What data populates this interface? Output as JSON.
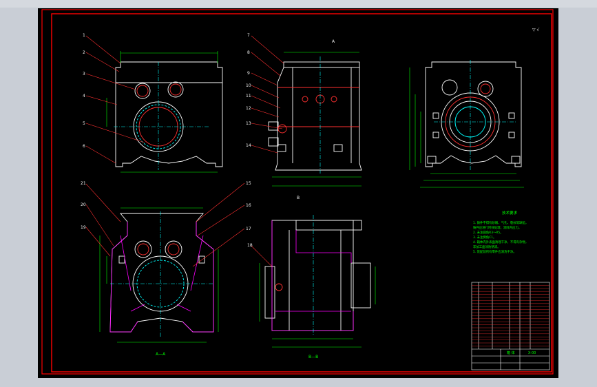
{
  "drawing": {
    "view_label_a": "A—A",
    "view_label_b": "B—B",
    "view_marker_a": "A",
    "view_marker_b": "B",
    "roughness": "▽ √",
    "tech_title": "技术要求",
    "tech_notes": [
      "1. 铸件不得有砂眼、气孔、裂纹等缺陷，",
      "   铸件应进行时效处理，消除内应力。",
      "2. 未注圆角R3～R5。",
      "3. 未注倒角C1。",
      "4. 箱体内外表面清理干净，不得有杂物，",
      "   非加工面涂防锈漆。",
      "5. 装配前所有零件应清洗干净。"
    ],
    "title_block": {
      "name": "箱 体",
      "code": "X-00"
    },
    "callouts_left": [
      "1",
      "2",
      "3",
      "4",
      "5",
      "6"
    ],
    "callouts_mid": [
      "7",
      "8",
      "9",
      "10",
      "11",
      "12",
      "13",
      "14"
    ],
    "callouts_bottom_left": [
      "21",
      "20",
      "19"
    ],
    "callouts_bottom_mid": [
      "15",
      "16",
      "17",
      "18"
    ]
  },
  "colors": {
    "frame": "#ff0000",
    "outline": "#ffffff",
    "dimension": "#00ff00",
    "leader": "#ff3030",
    "center": "#00ffff",
    "hidden": "#ffff00",
    "section": "#ff00ff"
  }
}
